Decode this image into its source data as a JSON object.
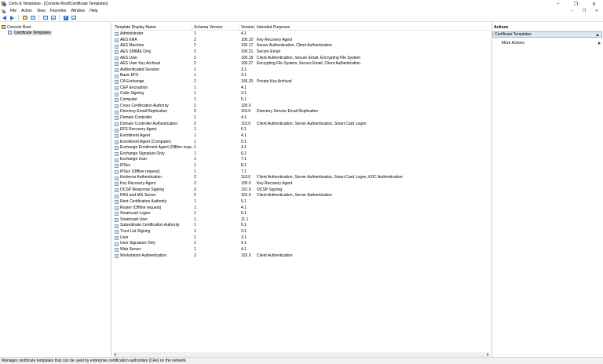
{
  "window": {
    "title": "Certs & Templates - [Console Root\\Certificate Templates]",
    "minimize": "–",
    "restore": "❐",
    "close": "✕"
  },
  "menu": {
    "items": [
      "File",
      "Action",
      "View",
      "Favorites",
      "Window",
      "Help"
    ],
    "mdi_minimize": "–",
    "mdi_restore": "❐",
    "mdi_close": "✕"
  },
  "toolbar": {
    "help_label": "?"
  },
  "tree": {
    "root": "Console Root",
    "child": "Certificate Templates"
  },
  "list": {
    "columns": [
      "Template Display Name",
      "Schema Version",
      "Version",
      "Intended Purposes"
    ],
    "rows": [
      {
        "name": "Administrator",
        "schema": "1",
        "version": "4.1",
        "purpose": ""
      },
      {
        "name": "AES KRA",
        "schema": "2",
        "version": "100.10",
        "purpose": "Key Recovery Agent"
      },
      {
        "name": "AES Machine",
        "schema": "2",
        "version": "100.17",
        "purpose": "Server Authentication, Client Authentication"
      },
      {
        "name": "AES SMIME Only",
        "schema": "2",
        "version": "100.21",
        "purpose": "Secure Email"
      },
      {
        "name": "AES User",
        "schema": "2",
        "version": "100.19",
        "purpose": "Client Authentication, Secure Email, Encrypting File System"
      },
      {
        "name": "AES User Key Archival",
        "schema": "2",
        "version": "100.27",
        "purpose": "Encrypting File System, Secure Email, Client Authentication"
      },
      {
        "name": "Authenticated Session",
        "schema": "1",
        "version": "3.1",
        "purpose": ""
      },
      {
        "name": "Basic EFS",
        "schema": "1",
        "version": "3.1",
        "purpose": ""
      },
      {
        "name": "CA Exchange",
        "schema": "2",
        "version": "106.20",
        "purpose": "Private Key Archival"
      },
      {
        "name": "CEP Encryption",
        "schema": "1",
        "version": "4.1",
        "purpose": ""
      },
      {
        "name": "Code Signing",
        "schema": "1",
        "version": "3.1",
        "purpose": ""
      },
      {
        "name": "Computer",
        "schema": "1",
        "version": "5.1",
        "purpose": ""
      },
      {
        "name": "Cross Certification Authority",
        "schema": "2",
        "version": "105.0",
        "purpose": ""
      },
      {
        "name": "Directory Email Replication",
        "schema": "2",
        "version": "115.0",
        "purpose": "Directory Service Email Replication"
      },
      {
        "name": "Domain Controller",
        "schema": "1",
        "version": "4.1",
        "purpose": ""
      },
      {
        "name": "Domain Controller Authentication",
        "schema": "2",
        "version": "110.0",
        "purpose": "Client Authentication, Server Authentication, Smart Card Logon"
      },
      {
        "name": "EFS Recovery Agent",
        "schema": "1",
        "version": "6.1",
        "purpose": ""
      },
      {
        "name": "Enrollment Agent",
        "schema": "1",
        "version": "4.1",
        "purpose": ""
      },
      {
        "name": "Enrollment Agent (Computer)",
        "schema": "1",
        "version": "5.1",
        "purpose": ""
      },
      {
        "name": "Exchange Enrollment Agent (Offline requ...",
        "schema": "1",
        "version": "4.1",
        "purpose": ""
      },
      {
        "name": "Exchange Signature Only",
        "schema": "1",
        "version": "6.1",
        "purpose": ""
      },
      {
        "name": "Exchange User",
        "schema": "1",
        "version": "7.1",
        "purpose": ""
      },
      {
        "name": "IPSec",
        "schema": "1",
        "version": "8.1",
        "purpose": ""
      },
      {
        "name": "IPSec (Offline request)",
        "schema": "1",
        "version": "7.1",
        "purpose": ""
      },
      {
        "name": "Kerberos Authentication",
        "schema": "2",
        "version": "110.0",
        "purpose": "Client Authentication, Server Authentication, Smart Card Logon, KDC Authentication"
      },
      {
        "name": "Key Recovery Agent",
        "schema": "2",
        "version": "105.0",
        "purpose": "Key Recovery Agent"
      },
      {
        "name": "OCSP Response Signing",
        "schema": "3",
        "version": "101.0",
        "purpose": "OCSP Signing"
      },
      {
        "name": "RAS and IAS Server",
        "schema": "2",
        "version": "101.0",
        "purpose": "Client Authentication, Server Authentication"
      },
      {
        "name": "Root Certification Authority",
        "schema": "1",
        "version": "5.1",
        "purpose": ""
      },
      {
        "name": "Router (Offline request)",
        "schema": "1",
        "version": "4.1",
        "purpose": ""
      },
      {
        "name": "Smartcard Logon",
        "schema": "1",
        "version": "6.1",
        "purpose": ""
      },
      {
        "name": "Smartcard User",
        "schema": "1",
        "version": "11.1",
        "purpose": ""
      },
      {
        "name": "Subordinate Certification Authority",
        "schema": "1",
        "version": "5.1",
        "purpose": ""
      },
      {
        "name": "Trust List Signing",
        "schema": "1",
        "version": "3.1",
        "purpose": ""
      },
      {
        "name": "User",
        "schema": "1",
        "version": "3.1",
        "purpose": ""
      },
      {
        "name": "User Signature Only",
        "schema": "1",
        "version": "4.1",
        "purpose": ""
      },
      {
        "name": "Web Server",
        "schema": "1",
        "version": "4.1",
        "purpose": ""
      },
      {
        "name": "Workstation Authentication",
        "schema": "2",
        "version": "102.0",
        "purpose": "Client Authentication"
      }
    ]
  },
  "actions": {
    "title": "Actions",
    "section": "Certificate Templates",
    "more": "More Actions"
  },
  "status": {
    "text": "Manages certificate templates that can be used by enterprise certification authorities (CAs) on the network"
  }
}
